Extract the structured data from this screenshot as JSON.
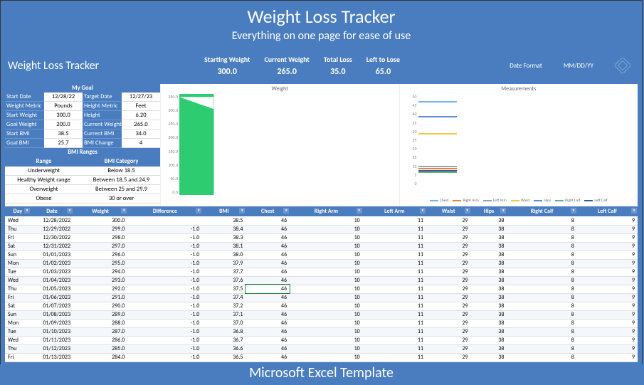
{
  "banner": {
    "title": "Weight Loss Tracker",
    "sub": "Everything on one page for ease of use",
    "footer": "Microsoft Excel Template"
  },
  "header": {
    "title": "Weight Loss Tracker",
    "metrics": [
      {
        "label": "Starting Weight",
        "value": "300.0"
      },
      {
        "label": "Current Weight",
        "value": "265.0"
      },
      {
        "label": "Total Loss",
        "value": "35.0"
      },
      {
        "label": "Left to Lose",
        "value": "65.0"
      }
    ],
    "dateFormatLabel": "Date Format",
    "dateFormatValue": "MM/DD/YY"
  },
  "goal": {
    "title": "My Goal",
    "rows": [
      {
        "l1": "Start Date",
        "v1": "12/28/22",
        "l2": "Target Date",
        "v2": "12/27/23"
      },
      {
        "l1": "Weight Metric",
        "v1": "Pounds",
        "l2": "Height Metric",
        "v2": "Feet"
      },
      {
        "l1": "Start Weight",
        "v1": "300.0",
        "l2": "Height",
        "v2": "6.20"
      },
      {
        "l1": "Goal Weight",
        "v1": "200.0",
        "l2": "Current Weight",
        "v2": "265.0"
      },
      {
        "l1": "Start BMI",
        "v1": "38.5",
        "l2": "Current BMI",
        "v2": "34.0"
      },
      {
        "l1": "Goal BMI",
        "v1": "25.7",
        "l2": "BMI Change",
        "v2": "4"
      }
    ]
  },
  "bmi": {
    "title": "BMI Ranges",
    "col1": "Range",
    "col2": "BMI Category",
    "rows": [
      {
        "r": "Underweight",
        "c": "Below 18.5"
      },
      {
        "r": "Healthy Weight range",
        "c": "Between 18.5 and 24.9"
      },
      {
        "r": "Overweight",
        "c": "Between 25 and 29.9"
      },
      {
        "r": "Obese",
        "c": "30 or over"
      }
    ]
  },
  "chart_data": [
    {
      "type": "line",
      "title": "Weight",
      "ylim": [
        0,
        350
      ],
      "yticks": [
        "350.0",
        "300.0",
        "250.0",
        "200.0",
        "150.0",
        "100.0",
        "50.0",
        "0.0"
      ],
      "series": [
        {
          "name": "Weight",
          "color": "#2ecc71",
          "values_range": [
            300,
            265
          ]
        }
      ]
    },
    {
      "type": "line",
      "title": "Measurements",
      "ylim": [
        0,
        50
      ],
      "yticks": [
        "50",
        "45",
        "40",
        "35",
        "30",
        "25",
        "20",
        "15",
        "10",
        "5",
        "0"
      ],
      "series": [
        {
          "name": "Chest",
          "color": "#6fb4e8",
          "value": 46
        },
        {
          "name": "Right Arm",
          "color": "#e8844a",
          "value": 10
        },
        {
          "name": "Left Arm",
          "color": "#9aa0a6",
          "value": 11
        },
        {
          "name": "Waist",
          "color": "#f2c744",
          "value": 29
        },
        {
          "name": "Hips",
          "color": "#5a8fd6",
          "value": 38
        },
        {
          "name": "Right Calf",
          "color": "#5fb878",
          "value": 8
        },
        {
          "name": "Left Calf",
          "color": "#3d5a99",
          "value": 9
        }
      ]
    }
  ],
  "table": {
    "columns": [
      "Day",
      "Date",
      "Weight",
      "Difference",
      "BMI",
      "Chest",
      "Right Arm",
      "Left Arm",
      "Waist",
      "Hips",
      "Right Calf",
      "Left Calf"
    ],
    "rows": [
      [
        "Wed",
        "12/28/2022",
        "300.0",
        "",
        "38.5",
        "46",
        "10",
        "11",
        "29",
        "38",
        "8",
        "9"
      ],
      [
        "Thu",
        "12/29/2022",
        "299.0",
        "-1.0",
        "38.4",
        "46",
        "10",
        "11",
        "29",
        "38",
        "8",
        "9"
      ],
      [
        "Fri",
        "12/30/2022",
        "298.0",
        "-1.0",
        "38.3",
        "46",
        "10",
        "11",
        "29",
        "38",
        "8",
        "9"
      ],
      [
        "Sat",
        "12/31/2022",
        "297.0",
        "-1.0",
        "38.1",
        "46",
        "10",
        "11",
        "29",
        "38",
        "8",
        "9"
      ],
      [
        "Sun",
        "01/01/2023",
        "296.0",
        "-1.0",
        "38.0",
        "46",
        "10",
        "11",
        "29",
        "38",
        "8",
        "9"
      ],
      [
        "Mon",
        "01/02/2023",
        "295.0",
        "-1.0",
        "37.9",
        "46",
        "10",
        "11",
        "29",
        "38",
        "8",
        "9"
      ],
      [
        "Tue",
        "01/03/2023",
        "294.0",
        "-1.0",
        "37.7",
        "46",
        "10",
        "11",
        "29",
        "38",
        "8",
        "9"
      ],
      [
        "Wed",
        "01/04/2023",
        "293.0",
        "-1.0",
        "37.6",
        "46",
        "10",
        "11",
        "29",
        "38",
        "8",
        "9"
      ],
      [
        "Thu",
        "01/05/2023",
        "292.0",
        "-1.0",
        "37.5",
        "46",
        "10",
        "11",
        "29",
        "38",
        "8",
        "9"
      ],
      [
        "Fri",
        "01/06/2023",
        "291.0",
        "-1.0",
        "37.4",
        "46",
        "10",
        "11",
        "29",
        "38",
        "8",
        "9"
      ],
      [
        "Sat",
        "01/07/2023",
        "290.0",
        "-1.0",
        "37.2",
        "46",
        "10",
        "11",
        "29",
        "38",
        "8",
        "9"
      ],
      [
        "Sun",
        "01/08/2023",
        "289.0",
        "-1.0",
        "37.1",
        "46",
        "10",
        "11",
        "29",
        "38",
        "8",
        "9"
      ],
      [
        "Mon",
        "01/09/2023",
        "288.0",
        "-1.0",
        "37.0",
        "46",
        "10",
        "11",
        "29",
        "38",
        "8",
        "9"
      ],
      [
        "Tue",
        "01/10/2023",
        "287.0",
        "-1.0",
        "36.8",
        "46",
        "10",
        "11",
        "29",
        "38",
        "8",
        "9"
      ],
      [
        "Wed",
        "01/11/2023",
        "286.0",
        "-1.0",
        "36.7",
        "46",
        "10",
        "11",
        "29",
        "38",
        "8",
        "9"
      ],
      [
        "Thu",
        "01/12/2023",
        "285.0",
        "-1.0",
        "36.6",
        "46",
        "10",
        "11",
        "29",
        "38",
        "8",
        "9"
      ],
      [
        "Fri",
        "01/13/2023",
        "284.0",
        "-1.0",
        "36.5",
        "46",
        "10",
        "11",
        "29",
        "38",
        "8",
        "9"
      ]
    ],
    "selectedRow": 8
  }
}
